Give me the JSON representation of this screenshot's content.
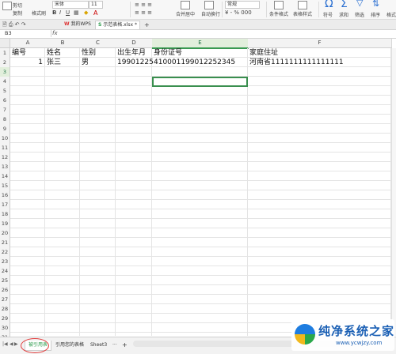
{
  "ribbon": {
    "paste": "格式刷",
    "cut": "剪切",
    "copy": "复制",
    "font_name": "宋体",
    "font_size": "11",
    "merge": "合并居中",
    "wrap": "自动换行",
    "number_format": "常规",
    "cond_format": "条件格式",
    "table_style": "表格样式",
    "symbol": "符号",
    "sum": "求和",
    "filter": "筛选",
    "sort": "排序",
    "format": "格式"
  },
  "doc_tabs": [
    "我的WPS",
    "示范表格.xlsx *"
  ],
  "formula_bar": {
    "name_box": "B3",
    "fx": "fx",
    "content": ""
  },
  "columns": [
    "A",
    "B",
    "C",
    "D",
    "E",
    "F"
  ],
  "selected_column": "E",
  "rows": [
    "1",
    "2",
    "3",
    "4",
    "5",
    "6",
    "7",
    "8",
    "9",
    "10",
    "11",
    "12",
    "13",
    "14",
    "15",
    "16",
    "17",
    "18",
    "19",
    "20",
    "21",
    "22",
    "23",
    "24",
    "25",
    "26",
    "27",
    "28",
    "29",
    "30",
    "31",
    "32",
    "33"
  ],
  "selected_row": "3",
  "cells": {
    "A1": "编号",
    "B1": "姓名",
    "C1": "性别",
    "D1": "出生年月",
    "E1": "身份证号",
    "F1": "家庭住址",
    "A2": "1",
    "B2": "张三",
    "C2": "男",
    "D2": "19901225",
    "E2": "410001199012252345",
    "F2": "河南省1111111111111111"
  },
  "sheets": [
    "被引用表",
    "引用您的表格",
    "Sheet3"
  ],
  "active_sheet": "被引用表",
  "add_sheet": "+",
  "more": "···",
  "watermark": {
    "title": "纯净系统之家",
    "url": "www.ycwjzy.com"
  },
  "colors": {
    "accent": "#3a8f4f",
    "highlight_ring": "#e23b3b",
    "brand": "#1a5fb4"
  }
}
